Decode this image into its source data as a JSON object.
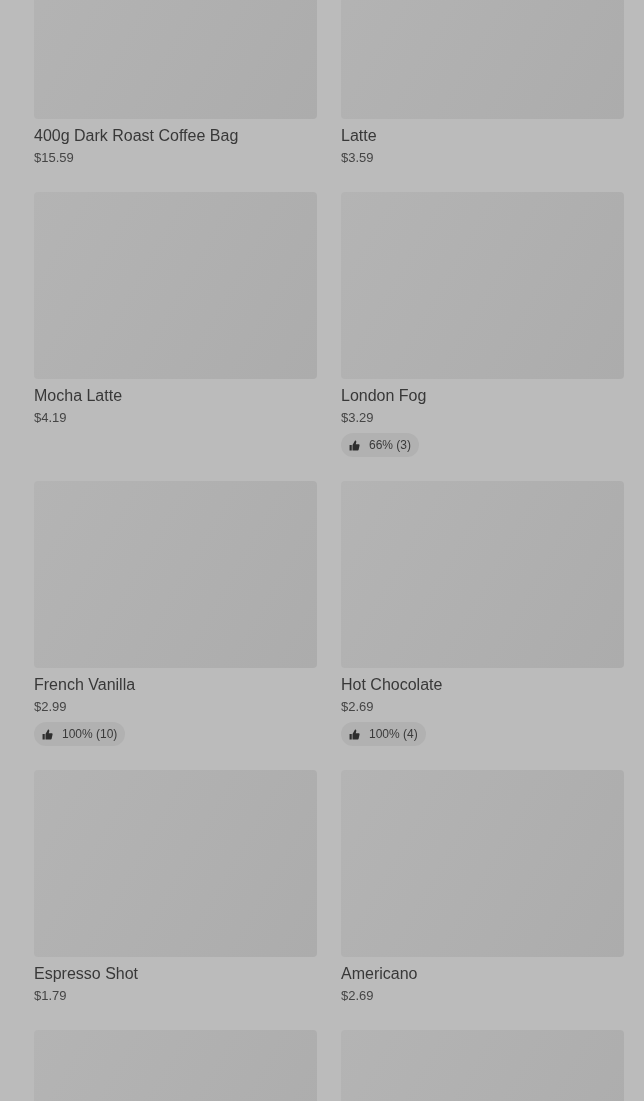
{
  "items": [
    {
      "kind": "product",
      "name": "400g Dark Roast Coffee Bag",
      "price": "$15.59"
    },
    {
      "kind": "product",
      "name": "Latte",
      "price": "$3.59"
    },
    {
      "kind": "product",
      "name": "Mocha Latte",
      "price": "$4.19"
    },
    {
      "kind": "product",
      "name": "London Fog",
      "price": "$3.29",
      "rating": "66% (3)"
    },
    {
      "kind": "product",
      "name": "French Vanilla",
      "price": "$2.99",
      "rating": "100% (10)"
    },
    {
      "kind": "product",
      "name": "Hot Chocolate",
      "price": "$2.69",
      "rating": "100% (4)"
    },
    {
      "kind": "product",
      "name": "Espresso Shot",
      "price": "$1.79"
    },
    {
      "kind": "product",
      "name": "Americano",
      "price": "$2.69"
    },
    {
      "kind": "image_only"
    },
    {
      "kind": "image_only"
    }
  ]
}
